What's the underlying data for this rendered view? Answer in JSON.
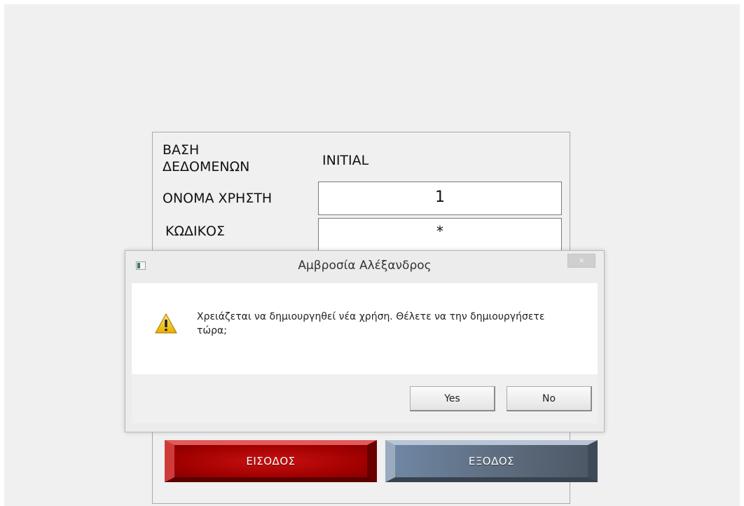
{
  "login_form": {
    "database_label": "ΒΑΣΗ ΔΕΔΟΜΕΝΩΝ",
    "database_value": "INITIAL",
    "username_label": "ΟΝΟΜΑ ΧΡΗΣΤΗ",
    "username_value": "1",
    "password_label": "ΚΩΔΙΚΟΣ",
    "password_value": "*",
    "enter_button": "ΕΙΣΟΔΟΣ",
    "exit_button": "ΕΞΟΔΟΣ"
  },
  "dialog": {
    "title": "Αμβροσία Αλέξανδρος",
    "close_label": "×",
    "message": "Χρειάζεται να δημιουργηθεί νέα χρήση. Θέλετε να την δημιουργήσετε τώρα;",
    "icon": "warning-icon",
    "yes_label": "Yes",
    "no_label": "No"
  },
  "colors": {
    "enter_button": "#a30000",
    "exit_button": "#6f7f93",
    "warning_icon": "#f2c200"
  }
}
